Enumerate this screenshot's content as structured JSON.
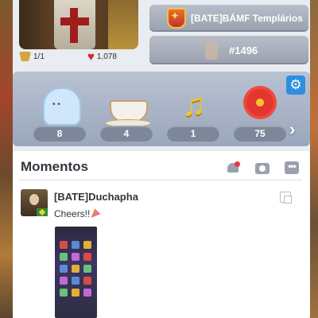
{
  "profile": {
    "ticket_count": "1/1",
    "likes_count": "1,078"
  },
  "clan": {
    "name": "[BATE]BÁMF Templários"
  },
  "rank": {
    "label": "#1496"
  },
  "collection": {
    "items": [
      {
        "icon": "ghost-icon",
        "count": "8"
      },
      {
        "icon": "teacup-icon",
        "count": "4"
      },
      {
        "icon": "music-note-icon",
        "count": "1"
      },
      {
        "icon": "flower-icon",
        "count": "75"
      }
    ]
  },
  "moments": {
    "title": "Momentos",
    "posts": [
      {
        "author": "[BATE]Duchapha",
        "text": "Cheers!!"
      }
    ]
  },
  "colors": {
    "settings_accent": "#2e8fe2",
    "notification_dot": "#e53935",
    "heart": "#d7262d"
  }
}
